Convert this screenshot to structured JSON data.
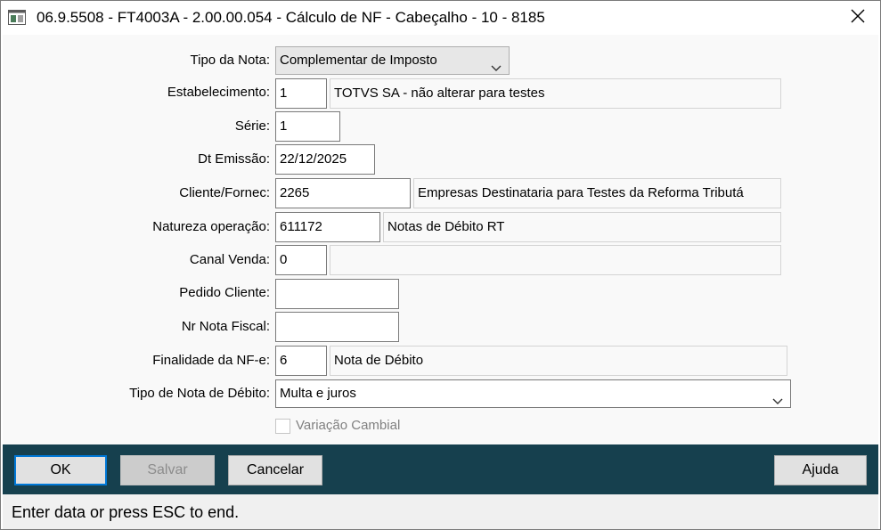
{
  "window": {
    "title": "06.9.5508 - FT4003A - 2.00.00.054 - Cálculo de NF - Cabeçalho - 10 - 8185"
  },
  "form": {
    "tipo_nota": {
      "label": "Tipo da Nota:",
      "value": "Complementar de Imposto"
    },
    "estabelecimento": {
      "label": "Estabelecimento:",
      "value": "1",
      "description": "TOTVS SA - não alterar para testes"
    },
    "serie": {
      "label": "Série:",
      "value": "1"
    },
    "dt_emissao": {
      "label": "Dt Emissão:",
      "value": "22/12/2025"
    },
    "cliente": {
      "label": "Cliente/Fornec:",
      "value": "2265",
      "description": "Empresas Destinataria para Testes da Reforma Tributá"
    },
    "natureza": {
      "label": "Natureza operação:",
      "value": "611172",
      "description": "Notas de Débito RT"
    },
    "canal_venda": {
      "label": "Canal Venda:",
      "value": "0",
      "description": ""
    },
    "pedido_cliente": {
      "label": "Pedido Cliente:",
      "value": ""
    },
    "nr_nota_fiscal": {
      "label": "Nr Nota Fiscal:",
      "value": ""
    },
    "finalidade": {
      "label": "Finalidade da NF-e:",
      "value": "6",
      "description": "Nota de Débito"
    },
    "tipo_nota_debito": {
      "label": "Tipo de Nota de Débito:",
      "value": "Multa e juros"
    },
    "variacao_cambial": {
      "label": "Variação Cambial",
      "checked": false
    }
  },
  "buttons": {
    "ok": "OK",
    "salvar": "Salvar",
    "cancelar": "Cancelar",
    "ajuda": "Ajuda"
  },
  "status": {
    "text": "Enter data or press ESC to end."
  },
  "colors": {
    "button_bar": "#16404e",
    "default_button_border": "#0078d7"
  },
  "icons": {
    "app": "window-app-icon",
    "close": "close-icon",
    "dropdown": "chevron-down-icon"
  }
}
